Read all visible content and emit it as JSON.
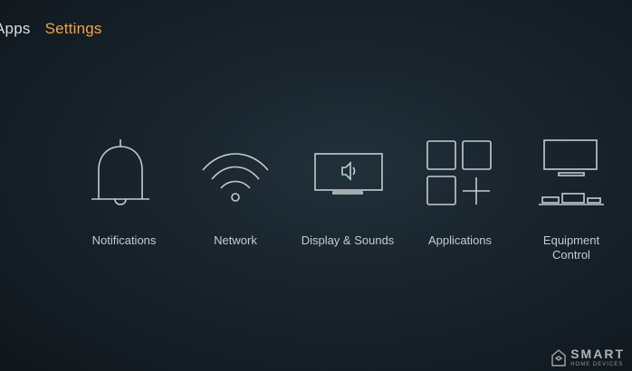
{
  "nav": {
    "items": [
      {
        "label": "Apps",
        "active": false
      },
      {
        "label": "Settings",
        "active": true
      }
    ]
  },
  "tiles": [
    {
      "label": "Notifications",
      "icon": "bell-icon"
    },
    {
      "label": "Network",
      "icon": "wifi-icon"
    },
    {
      "label": "Display & Sounds",
      "icon": "display-speaker-icon"
    },
    {
      "label": "Applications",
      "icon": "app-grid-icon"
    },
    {
      "label": "Equipment\nControl",
      "icon": "tv-devices-icon"
    }
  ],
  "watermark": {
    "title": "SMART",
    "subtitle": "HOME DEVICES"
  },
  "colors": {
    "accent": "#f0a443",
    "icon_stroke": "#c3cbcf",
    "background": "#18232b"
  }
}
